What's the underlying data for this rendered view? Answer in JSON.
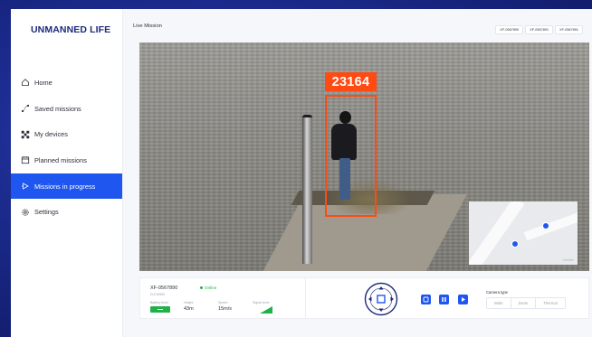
{
  "app": {
    "logo_text": "UNMANNED LIFE",
    "brand_color": "#1d2a7a",
    "accent_color": "#1f56f0"
  },
  "sidebar": {
    "items": [
      {
        "label": "Home",
        "icon": "home-icon"
      },
      {
        "label": "Saved missions",
        "icon": "route-icon"
      },
      {
        "label": "My devices",
        "icon": "drone-icon"
      },
      {
        "label": "Planned missions",
        "icon": "calendar-icon"
      },
      {
        "label": "Missions in progress",
        "icon": "play-outline-icon",
        "active": true
      },
      {
        "label": "Settings",
        "icon": "gear-icon"
      }
    ]
  },
  "main": {
    "page_title": "Live Mission",
    "device_tabs": [
      "XF-0567890",
      "XF-0567891",
      "XF-0567891"
    ]
  },
  "video": {
    "detection_id": "23164",
    "detection_color": "#ff4a12",
    "map_label": "Satellite"
  },
  "control": {
    "device_id": "XF-0567890",
    "status": "Online",
    "status_color": "#23b04a",
    "device_sub": "DJI M300",
    "stats": [
      {
        "label": "Battery level",
        "value": ""
      },
      {
        "label": "Height",
        "value": "43m"
      },
      {
        "label": "Speed",
        "value": "15m/s"
      },
      {
        "label": "Signal level",
        "value": ""
      }
    ],
    "camera_label": "Camera type",
    "camera_options": [
      "Wide",
      "Zoom",
      "Thermal"
    ],
    "camera_selected": "Wide"
  }
}
